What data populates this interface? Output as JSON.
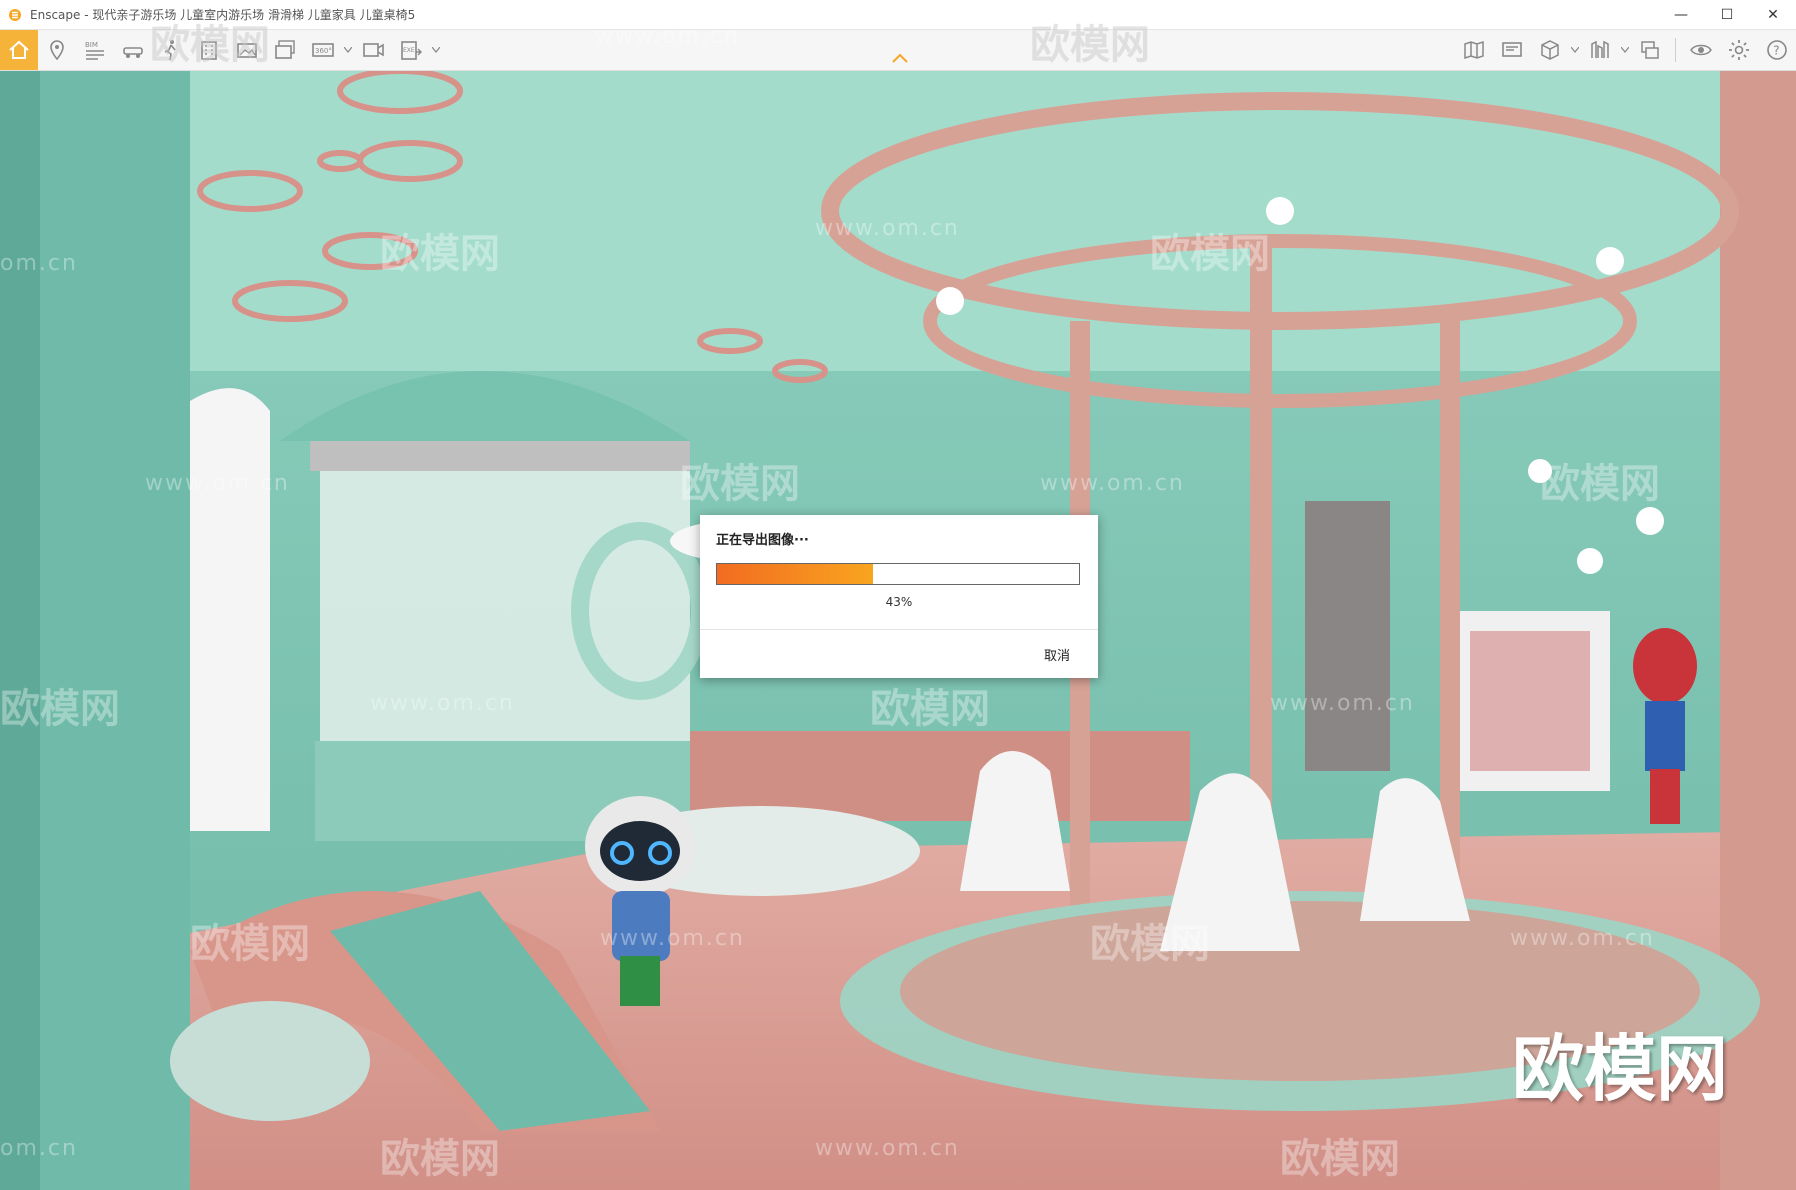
{
  "window": {
    "app_name": "Enscape",
    "title": "Enscape - 现代亲子游乐场 儿童室内游乐场 滑滑梯 儿童家具 儿童桌椅5",
    "controls": {
      "minimize": "—",
      "maximize": "☐",
      "close": "✕"
    }
  },
  "toolbar": {
    "active": "home",
    "left_icons": [
      "home-icon",
      "location-pin-icon",
      "bim-icon",
      "vehicle-icon",
      "person-walk-icon",
      "building-icon",
      "image-export-icon",
      "batch-render-icon",
      "panorama-360-icon",
      "video-export-icon",
      "exe-export-icon"
    ],
    "bim_label": "BIM",
    "panorama_label": "360°",
    "exe_label": "EXE",
    "right_icons": [
      "map-icon",
      "screen-icon",
      "cube-icon",
      "asset-library-icon",
      "sync-icon",
      "visibility-icon",
      "settings-icon",
      "help-icon"
    ],
    "help_label": "?"
  },
  "dialog": {
    "title": "正在导出图像···",
    "progress_percent": 43,
    "progress_text": "43%",
    "cancel_label": "取消"
  },
  "watermarks": {
    "cn": "欧模网",
    "url": "www.om.cn",
    "url_short": "om.cn",
    "brand": "欧模网"
  },
  "colors": {
    "accent": "#f6b33a",
    "progress_start": "#f26b21",
    "progress_end": "#f9a51f",
    "wall": "#7fc7b5",
    "floor": "#dba39a",
    "pink": "#d99a8e"
  }
}
